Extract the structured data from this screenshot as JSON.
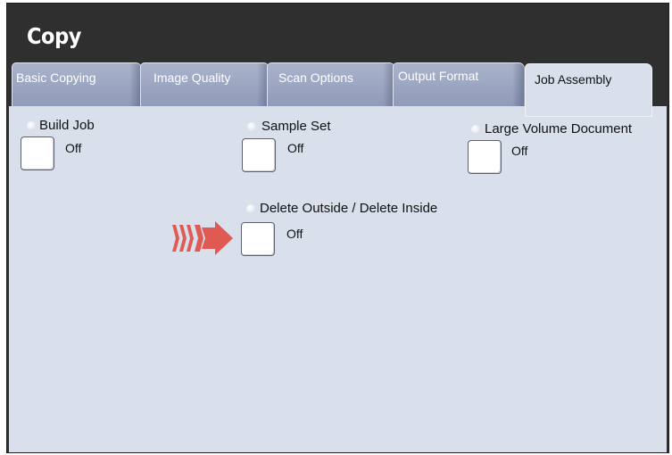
{
  "header": {
    "title": "Copy"
  },
  "tabs": [
    {
      "label": "Basic Copying"
    },
    {
      "label": "Image Quality"
    },
    {
      "label": "Scan Options"
    },
    {
      "label": "Output Format"
    },
    {
      "label": "Job Assembly",
      "active": true
    }
  ],
  "options": {
    "build_job": {
      "label": "Build Job",
      "value": "Off"
    },
    "sample_set": {
      "label": "Sample Set",
      "value": "Off"
    },
    "large_volume": {
      "label": "Large Volume Document",
      "value": "Off"
    },
    "delete_outside": {
      "label": "Delete Outside / Delete Inside",
      "value": "Off"
    }
  },
  "colors": {
    "title_bar": "#2f2f30",
    "panel": "#d9dfeb",
    "tab_inactive": "#98a3bf",
    "pointer_arrow": "#e05a54"
  },
  "icons": {
    "pointer": "right-arrow-icon"
  }
}
